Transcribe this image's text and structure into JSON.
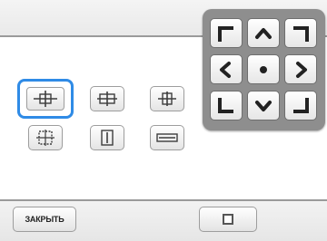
{
  "colors": {
    "selected_outline": "#2f8be6",
    "dpad_background": "#8e8e8e",
    "icon_stroke": "#3d3d3d"
  },
  "footer": {
    "close_label": "ЗАКРЫТЬ",
    "stop_icon": "square-icon"
  },
  "dpad": {
    "icons": [
      "arrow-up-left-corner-icon",
      "arrow-up-icon",
      "arrow-up-right-corner-icon",
      "arrow-left-icon",
      "center-dot-icon",
      "arrow-right-icon",
      "arrow-down-left-corner-icon",
      "arrow-down-icon",
      "arrow-down-right-corner-icon"
    ]
  },
  "stitch_styles": {
    "selected_index": 0,
    "icons": [
      "frame-cross-both-icon",
      "frame-cross-icon",
      "frame-cross-small-icon",
      "frame-square-icon",
      "frame-vertical-icon",
      "frame-horizontal-icon"
    ]
  }
}
